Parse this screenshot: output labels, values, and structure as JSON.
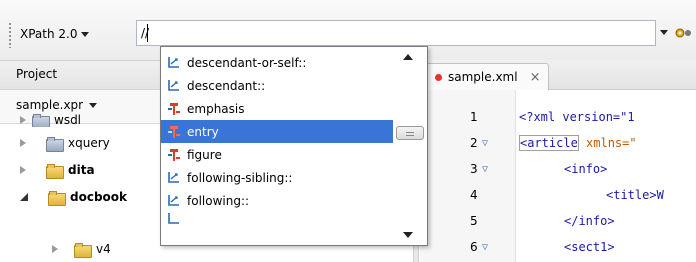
{
  "toolbar": {
    "xpath_version": "XPath 2.0",
    "xpath_value": "//"
  },
  "project": {
    "header_label": "Project",
    "selector_label": "sample.xpr",
    "tree": [
      {
        "label": "wsdl",
        "bold": false
      },
      {
        "label": "xquery",
        "bold": false
      },
      {
        "label": "dita",
        "bold": true
      },
      {
        "label": "docbook",
        "bold": true
      },
      {
        "label": "v4",
        "bold": false
      }
    ]
  },
  "editor": {
    "tab_label": "sample.xml",
    "tab_close": "×",
    "lines": [
      {
        "n": "1",
        "fold": false
      },
      {
        "n": "2",
        "fold": true
      },
      {
        "n": "3",
        "fold": true
      },
      {
        "n": "4",
        "fold": false
      },
      {
        "n": "5",
        "fold": false
      },
      {
        "n": "6",
        "fold": true
      }
    ],
    "code": {
      "l1": "<?xml version=\"1",
      "l2_tag": "<article",
      "l2_attr": " xmlns=\"",
      "l3": "<info>",
      "l4": "<title>W",
      "l5": "</info>",
      "l6": "<sect1>"
    }
  },
  "autocomplete": {
    "items": [
      {
        "label": "descendant-or-self::",
        "kind": "axis"
      },
      {
        "label": "descendant::",
        "kind": "axis"
      },
      {
        "label": "emphasis",
        "kind": "element"
      },
      {
        "label": "entry",
        "kind": "element",
        "selected": true
      },
      {
        "label": "figure",
        "kind": "element"
      },
      {
        "label": "following-sibling::",
        "kind": "axis"
      },
      {
        "label": "following::",
        "kind": "axis"
      }
    ],
    "selection_color": "#3875d7"
  }
}
